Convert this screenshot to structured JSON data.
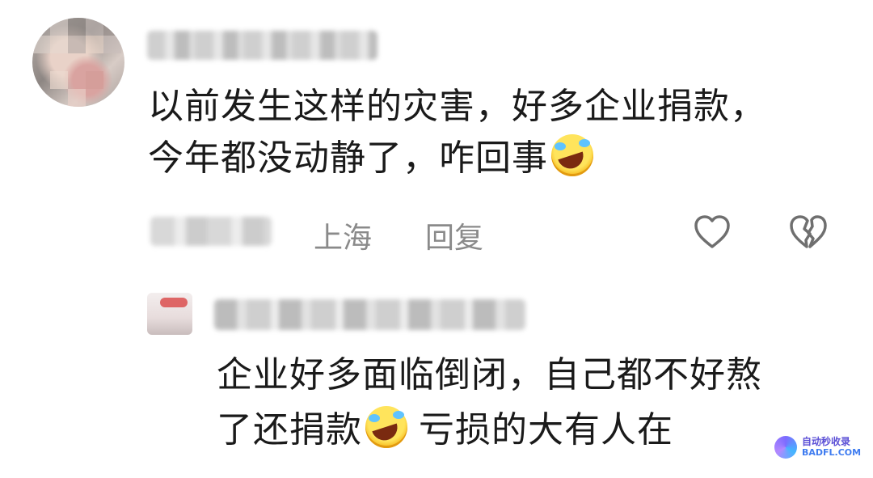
{
  "comment_main": {
    "line1": "以前发生这样的灾害，好多企业捐款，",
    "line2": "今年都没动静了，咋回事",
    "emoji": "laughing-crying-emoji",
    "location": "上海",
    "reply_label": "回复"
  },
  "comment_reply": {
    "line1": "企业好多面临倒闭，自己都不好熬",
    "line2_a": "了还捐款",
    "line2_b": "亏损的大有人在",
    "emoji": "laughing-crying-emoji"
  },
  "icons": {
    "like": "heart-outline-icon",
    "dislike": "broken-heart-icon"
  },
  "watermark": {
    "cn": "自动秒收录",
    "en": "BADFL.COM"
  },
  "colors": {
    "text": "#1a1a1a",
    "meta": "#8a8a8a",
    "icon": "#6f6f6f"
  }
}
